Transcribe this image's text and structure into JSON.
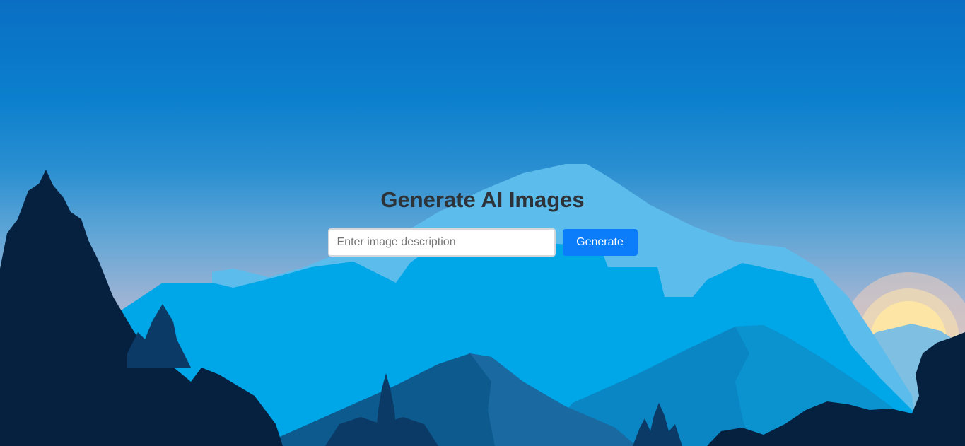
{
  "hero": {
    "title": "Generate AI Images"
  },
  "form": {
    "input_value": "",
    "input_placeholder": "Enter image description",
    "button_label": "Generate"
  },
  "colors": {
    "title_text": "#2d3338",
    "button_bg": "#0b7dfa",
    "button_text": "#ffffff",
    "sky_top": "#0a6fc4",
    "mountain_light": "#00a7e8",
    "forest_dark": "#05213f"
  },
  "background": {
    "description_icon": "mountain-landscape-illustration"
  }
}
